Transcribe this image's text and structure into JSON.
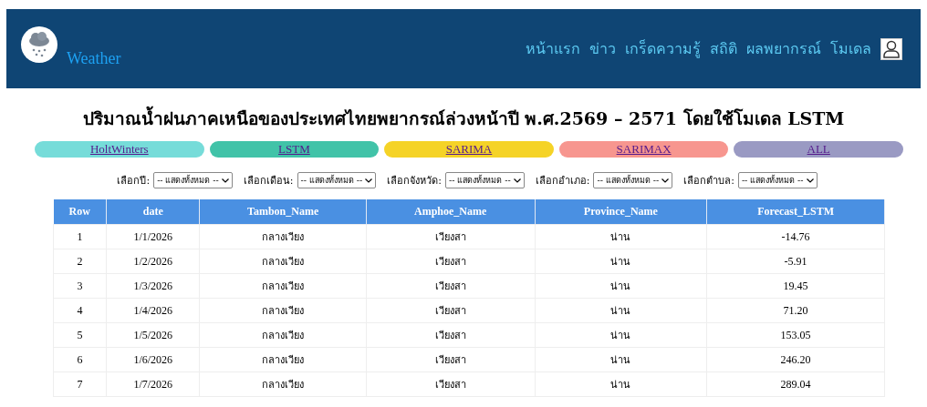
{
  "header": {
    "logo_text": "Weather",
    "nav": [
      "หน้าแรก",
      "ข่าว",
      "เกร็ดความรู้",
      "สถิติ",
      "ผลพยากรณ์",
      "โมเดล"
    ]
  },
  "title": "ปริมาณน้ำฝนภาคเหนือของประเทศไทยพยากรณ์ล่วงหน้าปี พ.ศ.2569 – 2571 โดยใช้โมเดล LSTM",
  "models": [
    {
      "label": "HoltWinters",
      "color": "#76dcd9"
    },
    {
      "label": "LSTM",
      "color": "#41c3a8"
    },
    {
      "label": "SARIMA",
      "color": "#f5d327"
    },
    {
      "label": "SARIMAX",
      "color": "#f7968f"
    },
    {
      "label": "ALL",
      "color": "#9a9ac3"
    }
  ],
  "filters": [
    {
      "label": "เลือกปี:",
      "value": "-- แสดงทั้งหมด --"
    },
    {
      "label": "เลือกเดือน:",
      "value": "-- แสดงทั้งหมด --"
    },
    {
      "label": "เลือกจังหวัด:",
      "value": "-- แสดงทั้งหมด --"
    },
    {
      "label": "เลือกอำเภอ:",
      "value": "-- แสดงทั้งหมด --"
    },
    {
      "label": "เลือกตำบล:",
      "value": "-- แสดงทั้งหมด --"
    }
  ],
  "table": {
    "columns": [
      "Row",
      "date",
      "Tambon_Name",
      "Amphoe_Name",
      "Province_Name",
      "Forecast_LSTM"
    ],
    "rows": [
      [
        "1",
        "1/1/2026",
        "กลางเวียง",
        "เวียงสา",
        "น่าน",
        "-14.76"
      ],
      [
        "2",
        "1/2/2026",
        "กลางเวียง",
        "เวียงสา",
        "น่าน",
        "-5.91"
      ],
      [
        "3",
        "1/3/2026",
        "กลางเวียง",
        "เวียงสา",
        "น่าน",
        "19.45"
      ],
      [
        "4",
        "1/4/2026",
        "กลางเวียง",
        "เวียงสา",
        "น่าน",
        "71.20"
      ],
      [
        "5",
        "1/5/2026",
        "กลางเวียง",
        "เวียงสา",
        "น่าน",
        "153.05"
      ],
      [
        "6",
        "1/6/2026",
        "กลางเวียง",
        "เวียงสา",
        "น่าน",
        "246.20"
      ],
      [
        "7",
        "1/7/2026",
        "กลางเวียง",
        "เวียงสา",
        "น่าน",
        "289.04"
      ]
    ]
  }
}
